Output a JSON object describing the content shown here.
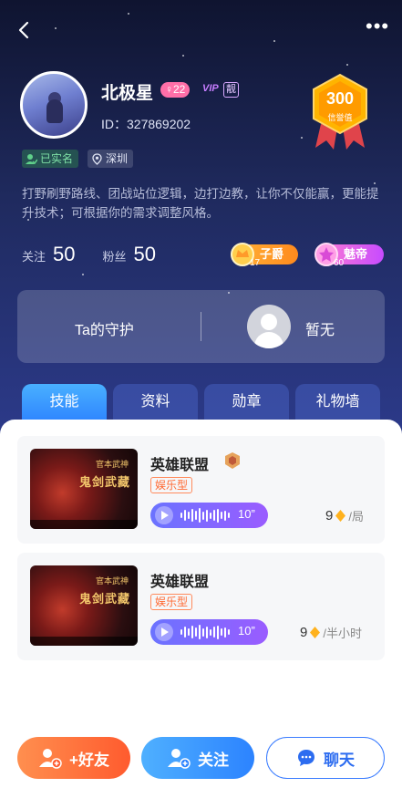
{
  "profile": {
    "name": "北极星",
    "age": "22",
    "vip_label": "VIP",
    "liang_label": "靓",
    "uid": "ID：327869202",
    "credit_value": "300",
    "credit_label": "信誉值",
    "verified_label": "已实名",
    "city": "深圳",
    "intro": "打野刷野路线、团战站位逻辑，边打边教，让你不仅能赢，更能提升技术；可根据你的需求调整风格。"
  },
  "stats": {
    "follow_label": "关注",
    "follow_value": "50",
    "fans_label": "粉丝",
    "fans_value": "50"
  },
  "badges": {
    "rank1": {
      "level": "17",
      "label": "子爵",
      "color": "#ff9a2a"
    },
    "rank2": {
      "level": "60",
      "label": "魅帝",
      "color": "#c74bff"
    }
  },
  "guard": {
    "title": "Ta的守护",
    "empty": "暂无"
  },
  "tabs": [
    "技能",
    "资料",
    "勋章",
    "礼物墙"
  ],
  "skills": [
    {
      "game": "英雄联盟",
      "type": "娱乐型",
      "duration": "10”",
      "price": "9",
      "unit": "/局",
      "has_badge": true
    },
    {
      "game": "英雄联盟",
      "type": "娱乐型",
      "duration": "10”",
      "price": "9",
      "unit": "/半小时",
      "has_badge": false
    }
  ],
  "actions": {
    "add_friend": "+好友",
    "follow": "关注",
    "chat": "聊天"
  },
  "colors": {
    "accent": "#2f86ff",
    "orange": "#ff5b2e",
    "age_badge": "#ff6fa8"
  }
}
